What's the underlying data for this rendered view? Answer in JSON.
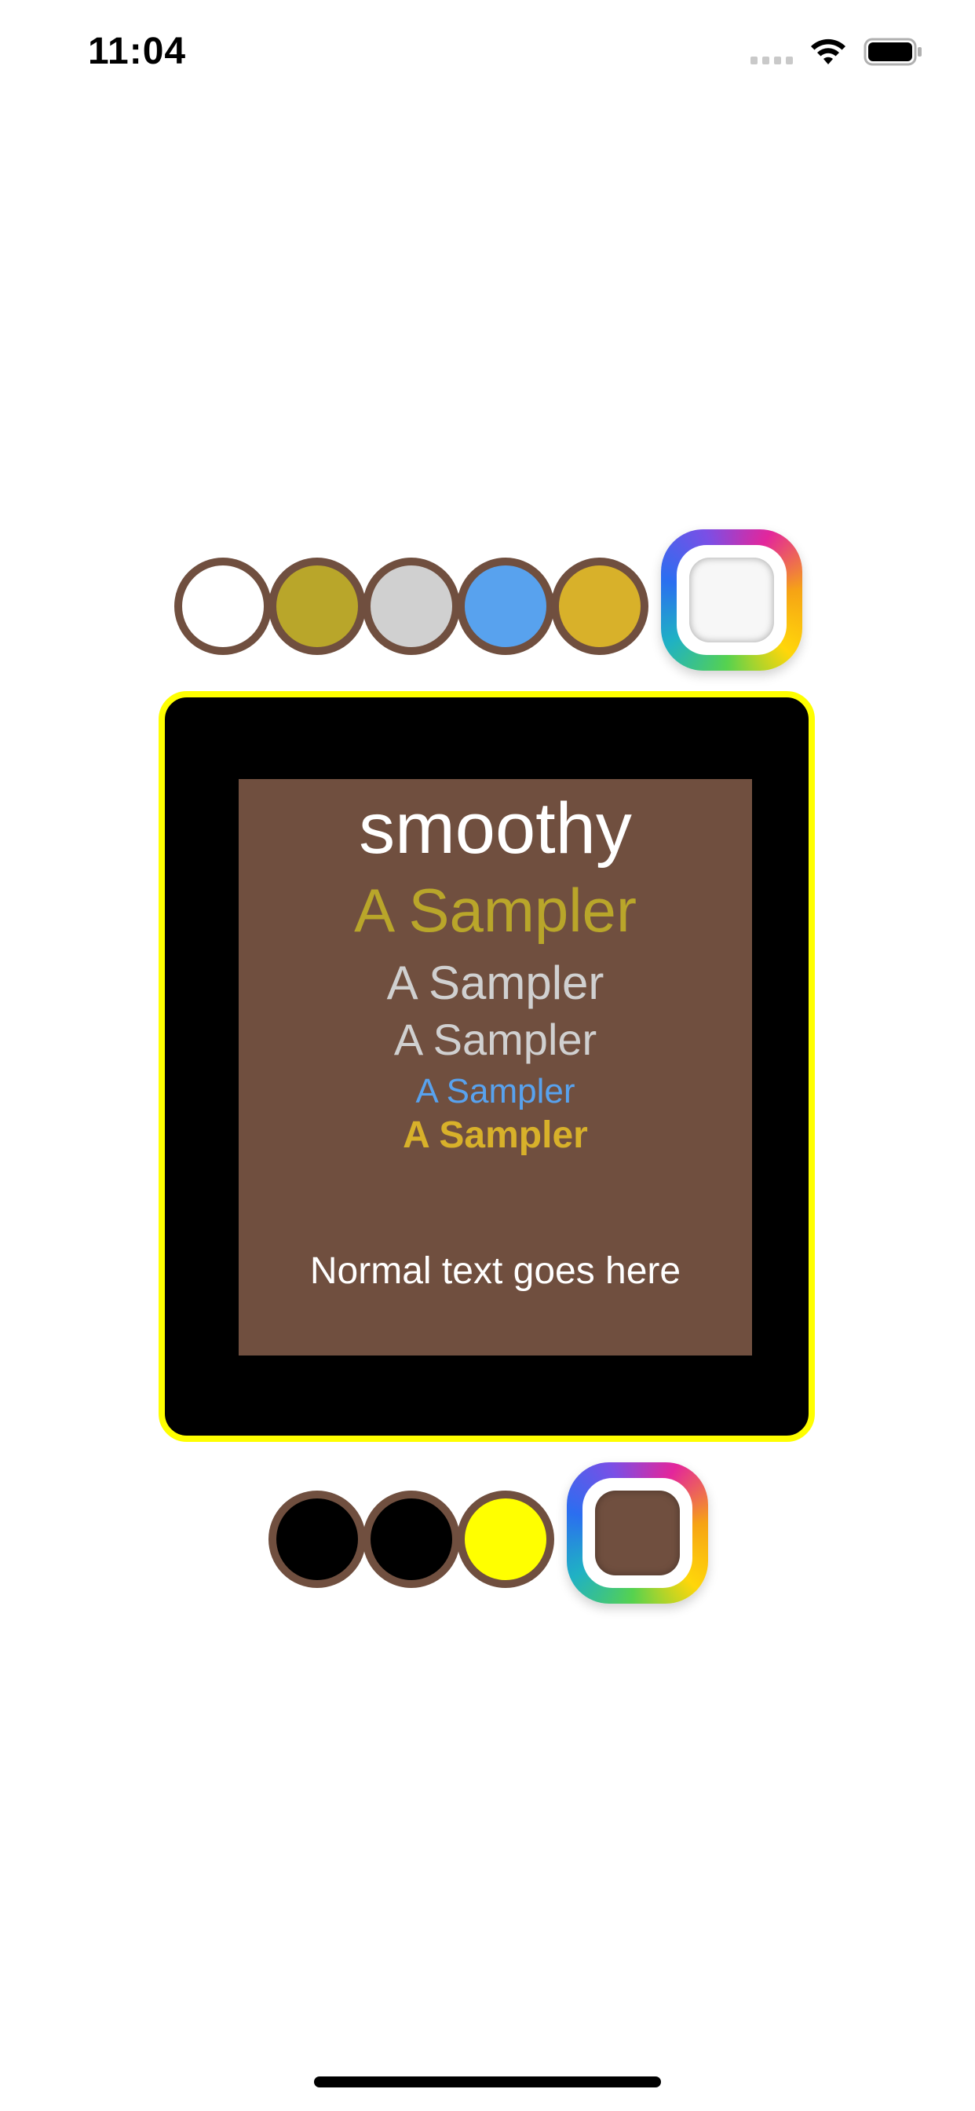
{
  "status_bar": {
    "time": "11:04",
    "icons": [
      "cellular-signal-icon",
      "wifi-icon",
      "battery-icon"
    ]
  },
  "text_palette": {
    "swatches": [
      {
        "name": "text-color-white",
        "color": "#ffffff"
      },
      {
        "name": "text-color-olive",
        "color": "#b9a62a"
      },
      {
        "name": "text-color-light-gray",
        "color": "#d0d0d0"
      },
      {
        "name": "text-color-blue",
        "color": "#58a2ee"
      },
      {
        "name": "text-color-gold",
        "color": "#d8b12a"
      }
    ],
    "picker_selected_color": "#f7f7f7",
    "swatch_border_color": "#704f3f"
  },
  "preview": {
    "title": "smoothy",
    "samples": [
      "A Sampler",
      "A Sampler",
      "A Sampler",
      "A Sampler",
      "A Sampler"
    ],
    "body_text": "Normal text goes here",
    "colors": {
      "title": "#ffffff",
      "sample_1": "#b9a62a",
      "sample_2": "#d0d0d0",
      "sample_3": "#d0d0d0",
      "sample_4": "#58a2ee",
      "sample_5": "#d8b12a",
      "body_text": "#ffffff",
      "content_background": "#704f3f",
      "frame_background": "#000000",
      "frame_border": "#ffff00"
    }
  },
  "background_palette": {
    "swatches": [
      {
        "name": "bg-color-black-1",
        "color": "#000000"
      },
      {
        "name": "bg-color-black-2",
        "color": "#000000"
      },
      {
        "name": "bg-color-yellow",
        "color": "#ffff00"
      }
    ],
    "picker_selected_color": "#704f3f"
  }
}
